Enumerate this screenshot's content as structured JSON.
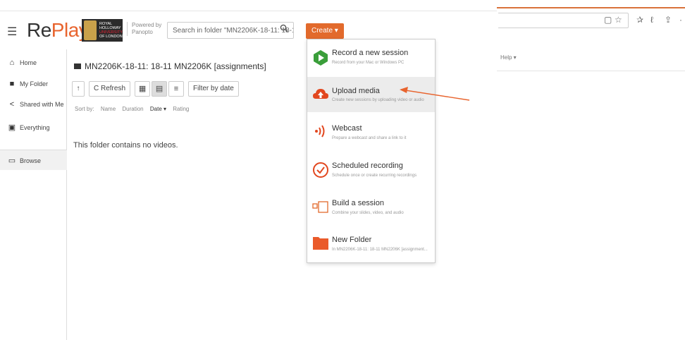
{
  "app": {
    "brand_re": "Re",
    "brand_play": "Play"
  },
  "logo": {
    "line1": "ROYAL",
    "line2": "HOLLOWAY",
    "line3": "UNIVERSITY",
    "line4": "OF LONDON"
  },
  "powered": {
    "line1": "Powered by",
    "line2": "Panopto"
  },
  "search": {
    "text": "Search in folder \"MN2206K-18-11: 18-1..."
  },
  "create": {
    "label": "Create ▾"
  },
  "sidebar": {
    "items": [
      {
        "label": "Home",
        "icon": "home-icon"
      },
      {
        "label": "My Folder",
        "icon": "folder-icon"
      },
      {
        "label": "Shared with Me",
        "icon": "share-icon"
      },
      {
        "label": "Everything",
        "icon": "everything-icon"
      },
      {
        "label": "Browse",
        "icon": "browse-icon"
      }
    ]
  },
  "main": {
    "folder_title": "MN2206K-18-11: 18-11 MN2206K [assignments]",
    "refresh": "C Refresh",
    "filter": "Filter by date",
    "sort_label": "Sort by:",
    "sort_options": [
      "Name",
      "Duration",
      "Date ▾",
      "Rating"
    ],
    "empty": "This folder contains no videos."
  },
  "help": "Help ▾",
  "menu": [
    {
      "title": "Record a new session",
      "desc": "Record from your Mac or Windows PC",
      "icon": "record-icon",
      "color": "#3a9e3a"
    },
    {
      "title": "Upload media",
      "desc": "Create new sessions by uploading video or audio",
      "icon": "upload-cloud-icon",
      "color": "#e2471f"
    },
    {
      "title": "Webcast",
      "desc": "Prepare a webcast and share a link to it",
      "icon": "webcast-icon",
      "color": "#e2471f"
    },
    {
      "title": "Scheduled recording",
      "desc": "Schedule once or create recurring recordings",
      "icon": "scheduled-icon",
      "color": "#e2471f"
    },
    {
      "title": "Build a session",
      "desc": "Combine your slides, video, and audio",
      "icon": "build-icon",
      "color": "#e26a2c"
    },
    {
      "title": "New Folder",
      "desc": "In MN2206K-18-11: 18-11 MN2206K [assignment...",
      "icon": "new-folder-icon",
      "color": "#ea5a2a"
    }
  ],
  "colors": {
    "accent": "#e26a2c",
    "arrow": "#e8642e"
  }
}
